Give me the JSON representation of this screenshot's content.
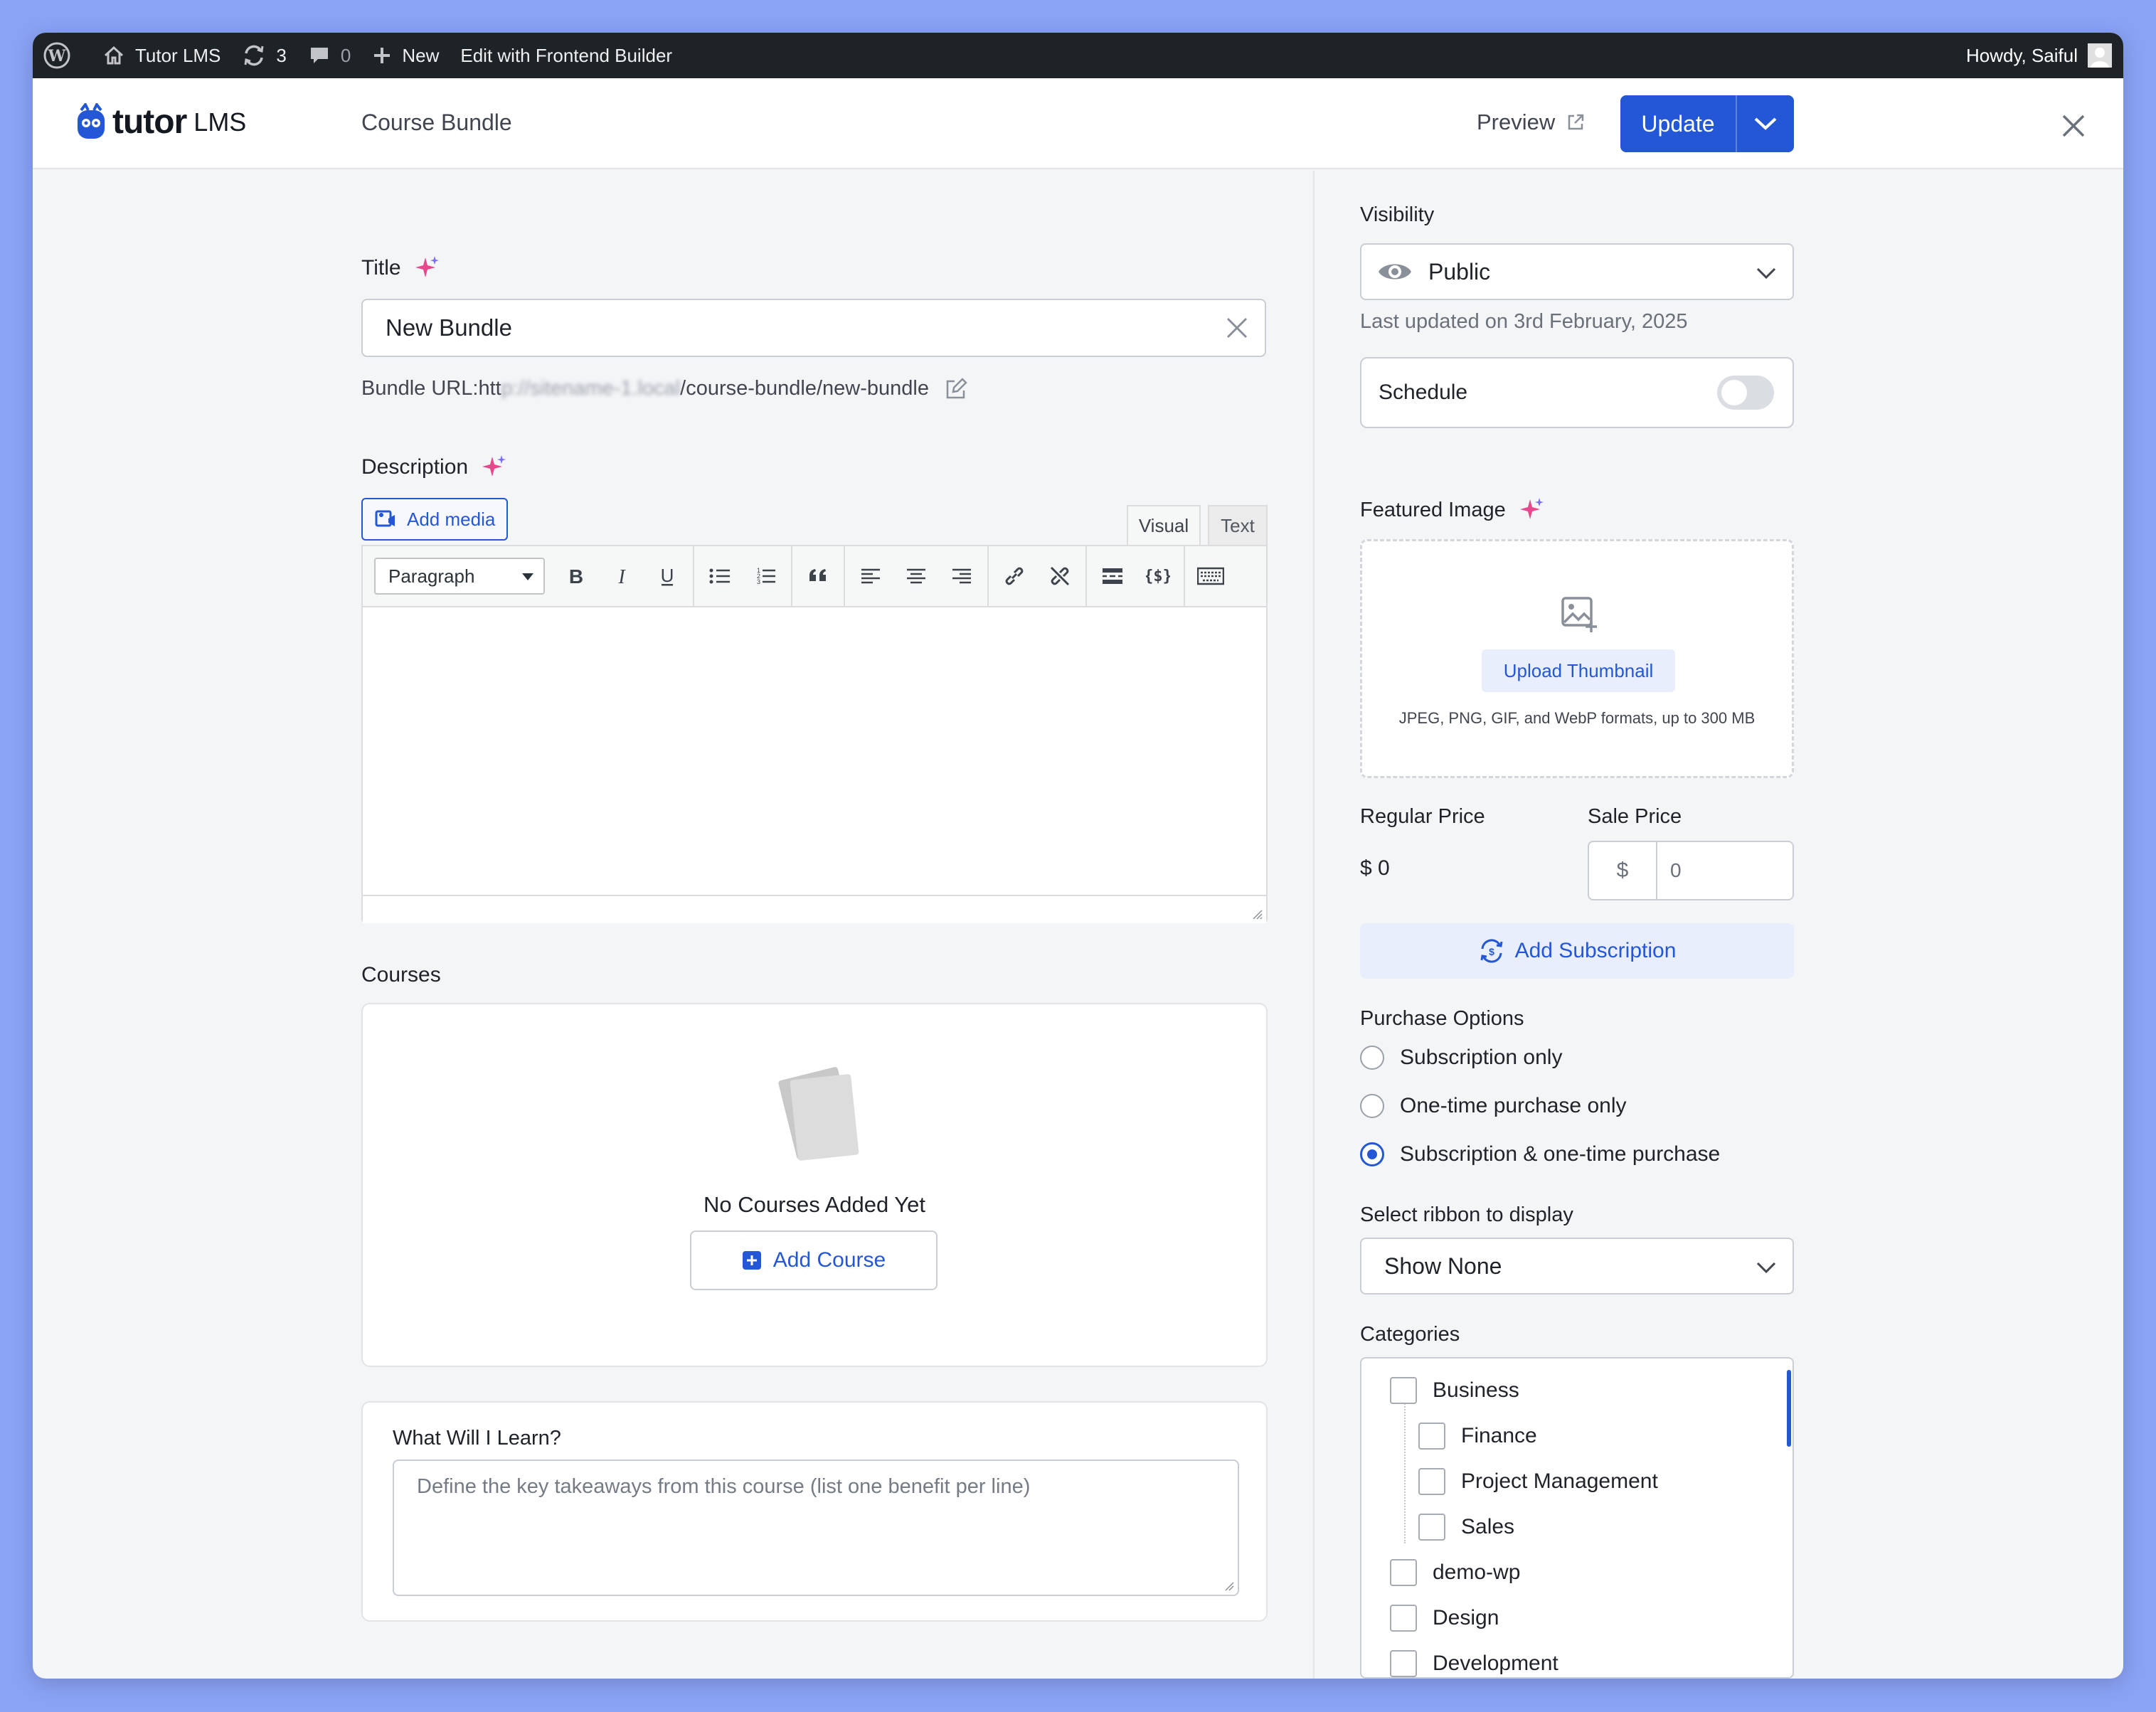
{
  "adminbar": {
    "site_name": "Tutor LMS",
    "updates_count": "3",
    "comments_count": "0",
    "new_label": "New",
    "frontend_builder": "Edit with Frontend Builder",
    "howdy": "Howdy, Saiful"
  },
  "header": {
    "logo_word": "tutor",
    "logo_suffix": "LMS",
    "page_title": "Course Bundle",
    "preview_label": "Preview",
    "update_label": "Update"
  },
  "main": {
    "title_label": "Title",
    "title_value": "New Bundle",
    "bundle_url_label": "Bundle URL: ",
    "bundle_url_prefix": "htt",
    "bundle_url_blurred": "p://sitename-1.local",
    "bundle_url_suffix": "/course-bundle/new-bundle",
    "description_label": "Description",
    "add_media_label": "Add media",
    "tab_visual": "Visual",
    "tab_text": "Text",
    "paragraph_select": "Paragraph",
    "courses_label": "Courses",
    "no_courses": "No Courses Added Yet",
    "add_course_label": "Add Course",
    "learn_label": "What Will I Learn?",
    "learn_placeholder": "Define the key takeaways from this course (list one benefit per line)"
  },
  "sidebar": {
    "visibility_label": "Visibility",
    "visibility_value": "Public",
    "last_updated": "Last updated on 3rd February, 2025",
    "schedule_label": "Schedule",
    "schedule_on": false,
    "featured_image_label": "Featured Image",
    "upload_thumbnail": "Upload Thumbnail",
    "thumbnail_hint": "JPEG, PNG, GIF, and WebP formats, up to 300 MB",
    "regular_price_label": "Regular Price",
    "regular_price_value": "$ 0",
    "sale_price_label": "Sale Price",
    "sale_currency": "$",
    "sale_value": "0",
    "add_subscription": "Add Subscription",
    "purchase_options_label": "Purchase Options",
    "purchase_options": [
      {
        "label": "Subscription only",
        "selected": false
      },
      {
        "label": "One-time purchase only",
        "selected": false
      },
      {
        "label": "Subscription & one-time purchase",
        "selected": true
      }
    ],
    "ribbon_label": "Select ribbon to display",
    "ribbon_value": "Show None",
    "categories_label": "Categories",
    "categories": [
      {
        "label": "Business",
        "checked": false
      },
      {
        "label": "Finance",
        "checked": false
      },
      {
        "label": "Project Management",
        "checked": false
      },
      {
        "label": "Sales",
        "checked": false
      },
      {
        "label": "demo-wp",
        "checked": false
      },
      {
        "label": "Design",
        "checked": false
      },
      {
        "label": "Development",
        "checked": false
      }
    ]
  },
  "colors": {
    "accent": "#2457d6",
    "adminbar": "#1d2327",
    "background": "#8aa3f5"
  }
}
